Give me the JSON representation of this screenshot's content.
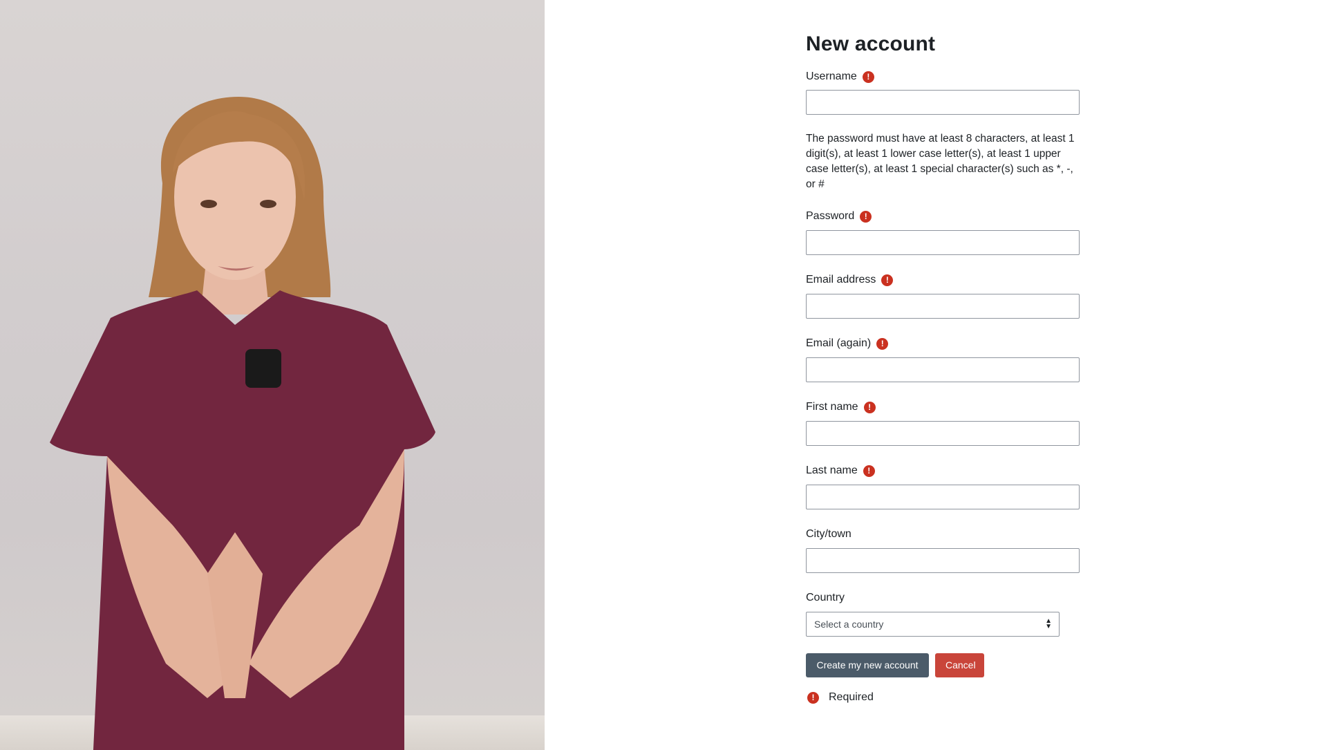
{
  "form": {
    "title": "New account",
    "password_hint": "The password must have at least 8 characters, at least 1 digit(s), at least 1 lower case letter(s), at least 1 upper case letter(s), at least 1 special character(s) such as *, -, or #",
    "fields": {
      "username": {
        "label": "Username",
        "value": "",
        "required": true
      },
      "password": {
        "label": "Password",
        "value": "",
        "required": true
      },
      "email": {
        "label": "Email address",
        "value": "",
        "required": true
      },
      "email_again": {
        "label": "Email (again)",
        "value": "",
        "required": true
      },
      "first_name": {
        "label": "First name",
        "value": "",
        "required": true
      },
      "last_name": {
        "label": "Last name",
        "value": "",
        "required": true
      },
      "city": {
        "label": "City/town",
        "value": "",
        "required": false
      },
      "country": {
        "label": "Country",
        "selected": "Select a country",
        "required": false
      }
    },
    "required_icon": "!",
    "buttons": {
      "create_label": "Create my new account",
      "cancel_label": "Cancel"
    },
    "required_note": "Required"
  },
  "colors": {
    "required": "#ca3120",
    "primary_button": "#4b5b69",
    "cancel_button": "#c9453a",
    "input_border": "#8f959e",
    "shirt": "#72263f"
  }
}
